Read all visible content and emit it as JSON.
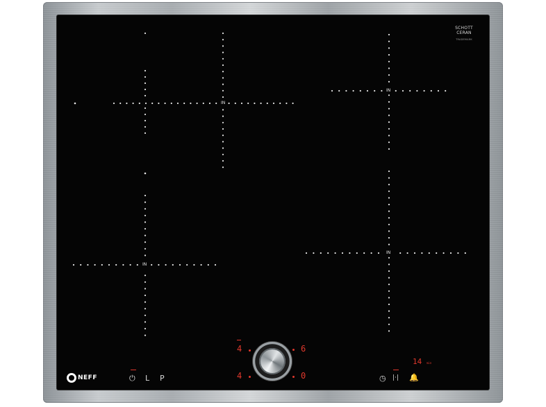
{
  "branding": {
    "glass_brand": "SCHOTT CERAN",
    "glass_brand_line2": "",
    "glass_sub": "TRADEMARK",
    "logo": "NEFF",
    "logo_icon": "neff-circle-logo"
  },
  "zones": [
    {
      "label": "IN"
    },
    {
      "label": "IN"
    },
    {
      "label": "IN"
    },
    {
      "label": "IN"
    }
  ],
  "controls": {
    "left_icons": [
      {
        "symbol": "⏻",
        "meaning": "power"
      },
      {
        "symbol": "L",
        "meaning": "lock"
      },
      {
        "symbol": "P",
        "meaning": "powerboost"
      }
    ],
    "displays": {
      "top_left": "4",
      "top_right": "6",
      "bottom_left": "4",
      "bottom_right": "0",
      "timer": "14",
      "timer_unit": "min"
    },
    "right_icons": [
      {
        "symbol": "◷",
        "meaning": "timer"
      },
      {
        "symbol": "|·|",
        "meaning": "timer-adjust"
      },
      {
        "symbol": "🔔",
        "meaning": "alarm"
      }
    ]
  }
}
